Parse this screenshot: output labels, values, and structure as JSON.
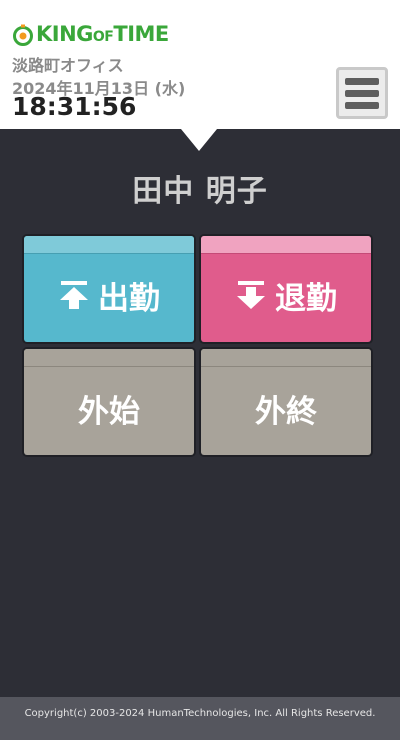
{
  "header": {
    "logo_text_1": "KING",
    "logo_text_2": "OF",
    "logo_text_3": "TIME",
    "office": "淡路町オフィス",
    "date": "2024年11月13日 (水)",
    "time": "18:31:56",
    "menu_icon": "hamburger-icon"
  },
  "employee": {
    "name": "田中 明子"
  },
  "buttons": {
    "clock_in": {
      "label": "出勤",
      "icon": "arrow-up-icon",
      "color": "#56b8cd"
    },
    "clock_out": {
      "label": "退勤",
      "icon": "arrow-down-icon",
      "color": "#e05c8c"
    },
    "out_start": {
      "label": "外始",
      "color": "#a8a39a"
    },
    "out_end": {
      "label": "外終",
      "color": "#a8a39a"
    }
  },
  "footer": {
    "copyright": "Copyright(c) 2003-2024 HumanTechnologies, Inc. All Rights Reserved."
  },
  "colors": {
    "brand_green": "#3aa73a",
    "background": "#2d2e36"
  }
}
